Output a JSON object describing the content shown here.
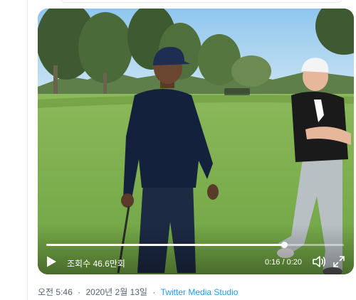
{
  "video": {
    "view_count": "조회수 46.6만회",
    "time_display": "0:16 / 0:20",
    "progress": 0.8,
    "controls": {
      "play_icon": "play-icon",
      "volume_icon": "volume-icon",
      "fullscreen_icon": "fullscreen-icon"
    }
  },
  "tweet_meta": {
    "time": "오전 5:46",
    "separator": "·",
    "date": "2020년 2월 13일",
    "source": "Twitter Media Studio"
  },
  "colors": {
    "link": "#1d9bf0",
    "meta_text": "#536471",
    "grass": "#7fae4e",
    "sky": "#9fd0f0"
  }
}
